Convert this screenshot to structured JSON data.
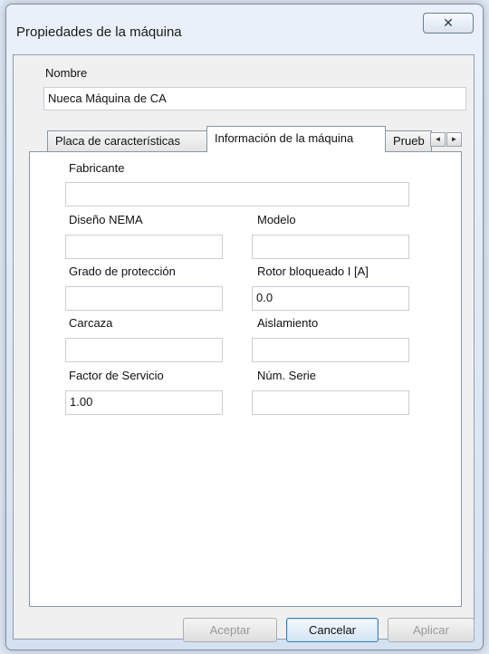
{
  "window": {
    "title": "Propiedades de la máquina",
    "close_symbol": "☒"
  },
  "name_field": {
    "label": "Nombre",
    "value": "Nueca Máquina de CA"
  },
  "tabs": [
    {
      "label": "Placa de características",
      "active": false
    },
    {
      "label": "Información de la máquina",
      "active": true
    },
    {
      "label": "Prueb",
      "active": false
    }
  ],
  "tab_scroll": {
    "left": "◄",
    "right": "►"
  },
  "fields": {
    "fabricante": {
      "label": "Fabricante",
      "value": ""
    },
    "diseno_nema": {
      "label": "Diseño NEMA",
      "value": ""
    },
    "modelo": {
      "label": "Modelo",
      "value": ""
    },
    "grado_proteccion": {
      "label": "Grado de protección",
      "value": ""
    },
    "rotor_bloqueado": {
      "label": "Rotor bloqueado I [A]",
      "value": "0.0"
    },
    "carcaza": {
      "label": "Carcaza",
      "value": ""
    },
    "aislamiento": {
      "label": "Aislamiento",
      "value": ""
    },
    "factor_servicio": {
      "label": "Factor de Servicio",
      "value": "1.00"
    },
    "num_serie": {
      "label": "Núm. Serie",
      "value": ""
    }
  },
  "buttons": {
    "aceptar": {
      "label": "Aceptar",
      "enabled": false
    },
    "cancelar": {
      "label": "Cancelar",
      "enabled": true
    },
    "aplicar": {
      "label": "Aplicar",
      "enabled": false
    }
  }
}
